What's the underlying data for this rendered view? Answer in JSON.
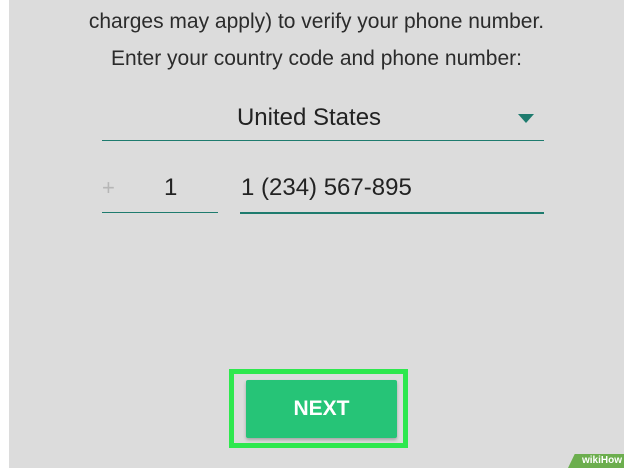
{
  "instructions": {
    "line1": "charges may apply) to verify your phone number.",
    "line2": "Enter your country code and phone number:"
  },
  "country_select": {
    "selected": "United States"
  },
  "country_code": {
    "prefix": "+",
    "value": "1"
  },
  "phone_number": {
    "value": "1 (234) 567-895"
  },
  "next_button": {
    "label": "NEXT"
  },
  "watermark": {
    "text": "wikiHow"
  },
  "colors": {
    "screen_background": "#dcdcdc",
    "accent_teal": "#1e7b6e",
    "button_green": "#26c477",
    "highlight_green": "#2ee84e"
  }
}
